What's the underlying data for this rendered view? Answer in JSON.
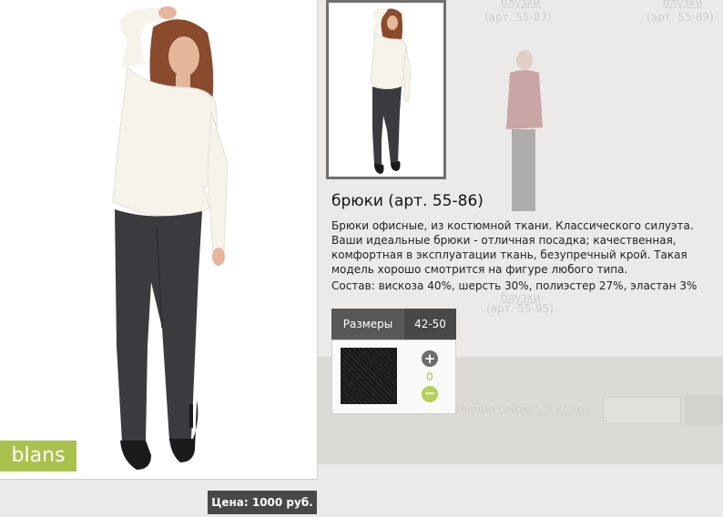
{
  "background": {
    "top_links": [
      "блузки",
      "блузки"
    ],
    "top_articles": [
      "(арт. 55-87)",
      "(арт. 55-89)"
    ],
    "mid_link": "блузки",
    "mid_article": "(арт. 55-95)",
    "footer_text": "Обновление сайта:",
    "footer_link": "«25-й кадр»"
  },
  "product": {
    "title": "брюки (арт. 55-86)",
    "description": "Брюки офисные, из костюмной ткани. Классического силуэта. Ваши идеальные брюки - отличная посадка; качественная, комфортная в эксплуатации ткань, безупречный крой. Такая модель хорошо смотрится на фигуре любого типа.",
    "composition": "Состав: вискоза 40%, шерсть 30%, полиэстер 27%, эластан 3%",
    "price": "Цена: 1000 руб.",
    "brand": "blans"
  },
  "sizes": {
    "header": "Размеры",
    "size": "42-50",
    "quantity": "0",
    "plus": "+",
    "minus": "−"
  },
  "colors": {
    "accent": "#a9c24d",
    "dark_header": "#484848",
    "trousers": "#3b3a3f",
    "top": "#f5f3ea"
  }
}
